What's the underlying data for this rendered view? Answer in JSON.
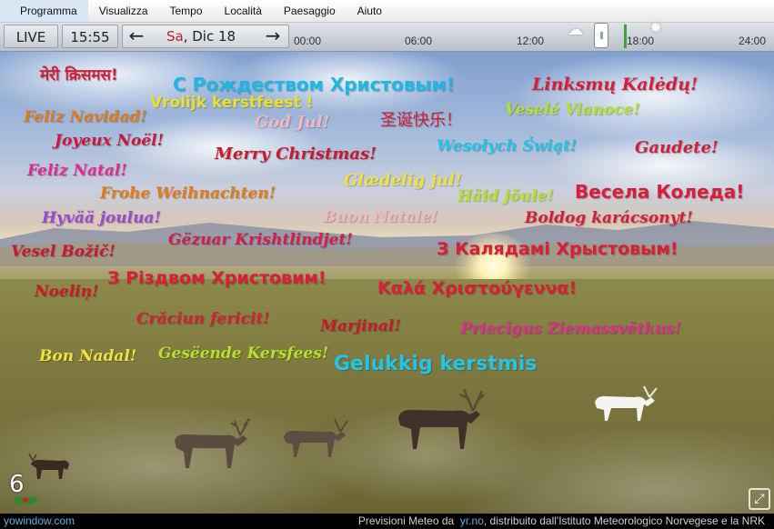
{
  "menu": [
    "Programma",
    "Visualizza",
    "Tempo",
    "Località",
    "Paesaggio",
    "Aiuto"
  ],
  "toolbar": {
    "live_label": "LIVE",
    "clock": "15:55",
    "prev_arrow": "←",
    "next_arrow": "→",
    "day": "Sa",
    "date": ", Dic 18",
    "ticks": [
      "00:00",
      "06:00",
      "12:00",
      "18:00",
      "24:00"
    ]
  },
  "greetings": [
    {
      "text": "मेरी क्रिसमस!",
      "color": "#d0203a"
    },
    {
      "text": "С Рождеством Христовым!",
      "color": "#1fb7e3"
    },
    {
      "text": "Linksmų Kalėdų!",
      "color": "#d81e38"
    },
    {
      "text": "Vrolijk kerstfeest !",
      "color": "#e8e02a"
    },
    {
      "text": "Feliz Navidad!",
      "color": "#e07b1c"
    },
    {
      "text": "God Jul!",
      "color": "#f2b7c1"
    },
    {
      "text": "圣诞快乐！",
      "color": "#d0203a"
    },
    {
      "text": "Veselé Vianoce!",
      "color": "#b6e02a"
    },
    {
      "text": "Joyeux Noël!",
      "color": "#c81a3e"
    },
    {
      "text": "Wesołych Świąt!",
      "color": "#24c4e8"
    },
    {
      "text": "Gaudete!",
      "color": "#d0203a"
    },
    {
      "text": "Merry Christmas!",
      "color": "#c81a2e"
    },
    {
      "text": "Feliz Natal!",
      "color": "#e02b8f"
    },
    {
      "text": "Glædelig jul!",
      "color": "#f0e040"
    },
    {
      "text": "Frohe Weihnachten!",
      "color": "#e07b1c"
    },
    {
      "text": "Häid jõule!",
      "color": "#b6e02a"
    },
    {
      "text": "Весела Коледа!",
      "color": "#d81e38"
    },
    {
      "text": "Hyvää joulua!",
      "color": "#9a4ad0"
    },
    {
      "text": "Buon Natale!",
      "color": "#f2b7c1"
    },
    {
      "text": "Boldog karácsonyt!",
      "color": "#d0203a"
    },
    {
      "text": "Gëzuar Krishtlindjet!",
      "color": "#d0204a"
    },
    {
      "text": "Vesel Božič!",
      "color": "#c81a2e"
    },
    {
      "text": "З Калядамі Хрыстовым!",
      "color": "#d81e38"
    },
    {
      "text": "З Різдвом Христовим!",
      "color": "#d81e38"
    },
    {
      "text": "Καλά Χριστούγεννα!",
      "color": "#d81e38"
    },
    {
      "text": "Noeliņ!",
      "color": "#c81a2e"
    },
    {
      "text": "Crăciun fericit!",
      "color": "#d0203a"
    },
    {
      "text": "Marjinal!",
      "color": "#c81a2e"
    },
    {
      "text": "Priecīgus Ziemassvētkus!",
      "color": "#e02b8f"
    },
    {
      "text": "Bon Nadal!",
      "color": "#f0e040"
    },
    {
      "text": "Gesëende Kersfees!",
      "color": "#b6e02a"
    },
    {
      "text": "Gelukkig kerstmis",
      "color": "#24c4e8"
    }
  ],
  "badge_number": "6",
  "footer": {
    "site": "yowindow.com",
    "credit_prefix": "Previsioni Meteo da",
    "credit_link": "yr.no",
    "credit_suffix": ", distribuito dall'Istituto Meteorologico Norvegese e la NRK"
  }
}
